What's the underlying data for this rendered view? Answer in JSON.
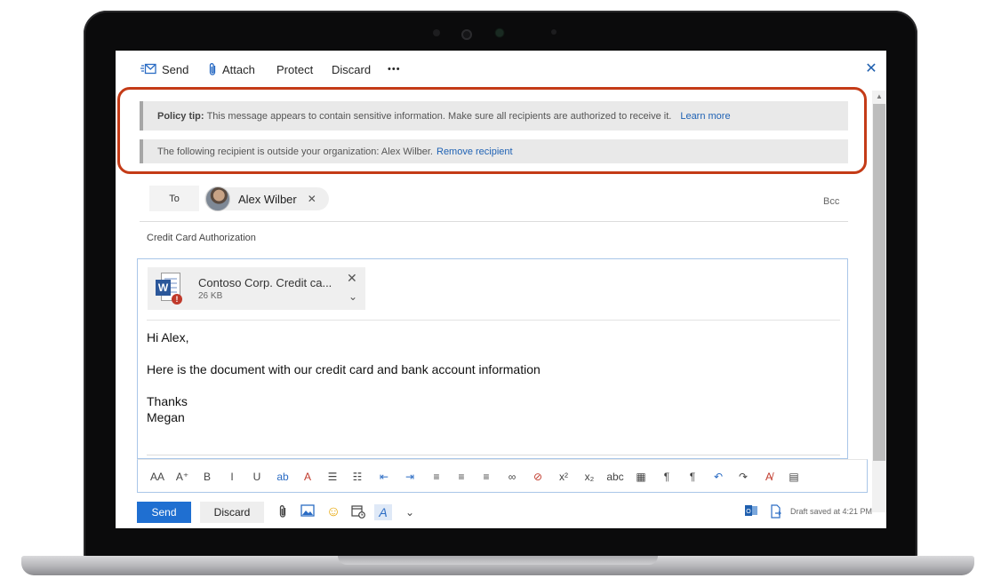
{
  "toolbar": {
    "send": "Send",
    "attach": "Attach",
    "protect": "Protect",
    "discard": "Discard",
    "more": "•••",
    "close": "✕"
  },
  "policy_tips": {
    "tip1_label": "Policy tip:",
    "tip1_text": "This message appears to contain sensitive information. Make sure all recipients are authorized to receive it.",
    "tip1_link": "Learn more",
    "tip2_text": "The following recipient is outside your organization: Alex Wilber.",
    "tip2_link": "Remove recipient"
  },
  "recipients": {
    "to_label": "To",
    "recipient_name": "Alex Wilber",
    "remove": "✕",
    "bcc_label": "Bcc"
  },
  "subject": "Credit Card Authorization",
  "attachment": {
    "name": "Contoso Corp. Credit ca...",
    "size": "26 KB",
    "icon_letter": "W",
    "alert": "!",
    "close": "✕",
    "expand": "⌄"
  },
  "message": {
    "line1": "Hi Alex,",
    "line2": "Here is the document with our credit card and bank account information",
    "line3": "Thanks",
    "line4": "Megan"
  },
  "format_toolbar": [
    {
      "name": "font-size-icon",
      "glyph": "AA"
    },
    {
      "name": "grow-font-icon",
      "glyph": "A⁺"
    },
    {
      "name": "bold-icon",
      "glyph": "B"
    },
    {
      "name": "italic-icon",
      "glyph": "I"
    },
    {
      "name": "underline-icon",
      "glyph": "U"
    },
    {
      "name": "highlight-icon",
      "glyph": "ab"
    },
    {
      "name": "font-color-icon",
      "glyph": "A"
    },
    {
      "name": "bullets-icon",
      "glyph": "☰"
    },
    {
      "name": "numbering-icon",
      "glyph": "☷"
    },
    {
      "name": "decrease-indent-icon",
      "glyph": "⇤"
    },
    {
      "name": "increase-indent-icon",
      "glyph": "⇥"
    },
    {
      "name": "align-left-icon",
      "glyph": "≡"
    },
    {
      "name": "align-center-icon",
      "glyph": "≡"
    },
    {
      "name": "align-right-icon",
      "glyph": "≡"
    },
    {
      "name": "link-icon",
      "glyph": "∞"
    },
    {
      "name": "unlink-icon",
      "glyph": "⊘"
    },
    {
      "name": "superscript-icon",
      "glyph": "x²"
    },
    {
      "name": "subscript-icon",
      "glyph": "x₂"
    },
    {
      "name": "strikethrough-icon",
      "glyph": "abc"
    },
    {
      "name": "insert-picture-icon",
      "glyph": "▦"
    },
    {
      "name": "ltr-icon",
      "glyph": "¶"
    },
    {
      "name": "rtl-icon",
      "glyph": "¶"
    },
    {
      "name": "undo-icon",
      "glyph": "↶"
    },
    {
      "name": "redo-icon",
      "glyph": "↷"
    },
    {
      "name": "clear-format-icon",
      "glyph": "A̸"
    },
    {
      "name": "table-icon",
      "glyph": "▤"
    }
  ],
  "bottom_bar": {
    "send": "Send",
    "discard": "Discard",
    "draft_status": "Draft saved at 4:21 PM"
  },
  "colors": {
    "accent": "#1f6fd1",
    "link": "#1f62b4",
    "highlight_border": "#c43b17"
  }
}
